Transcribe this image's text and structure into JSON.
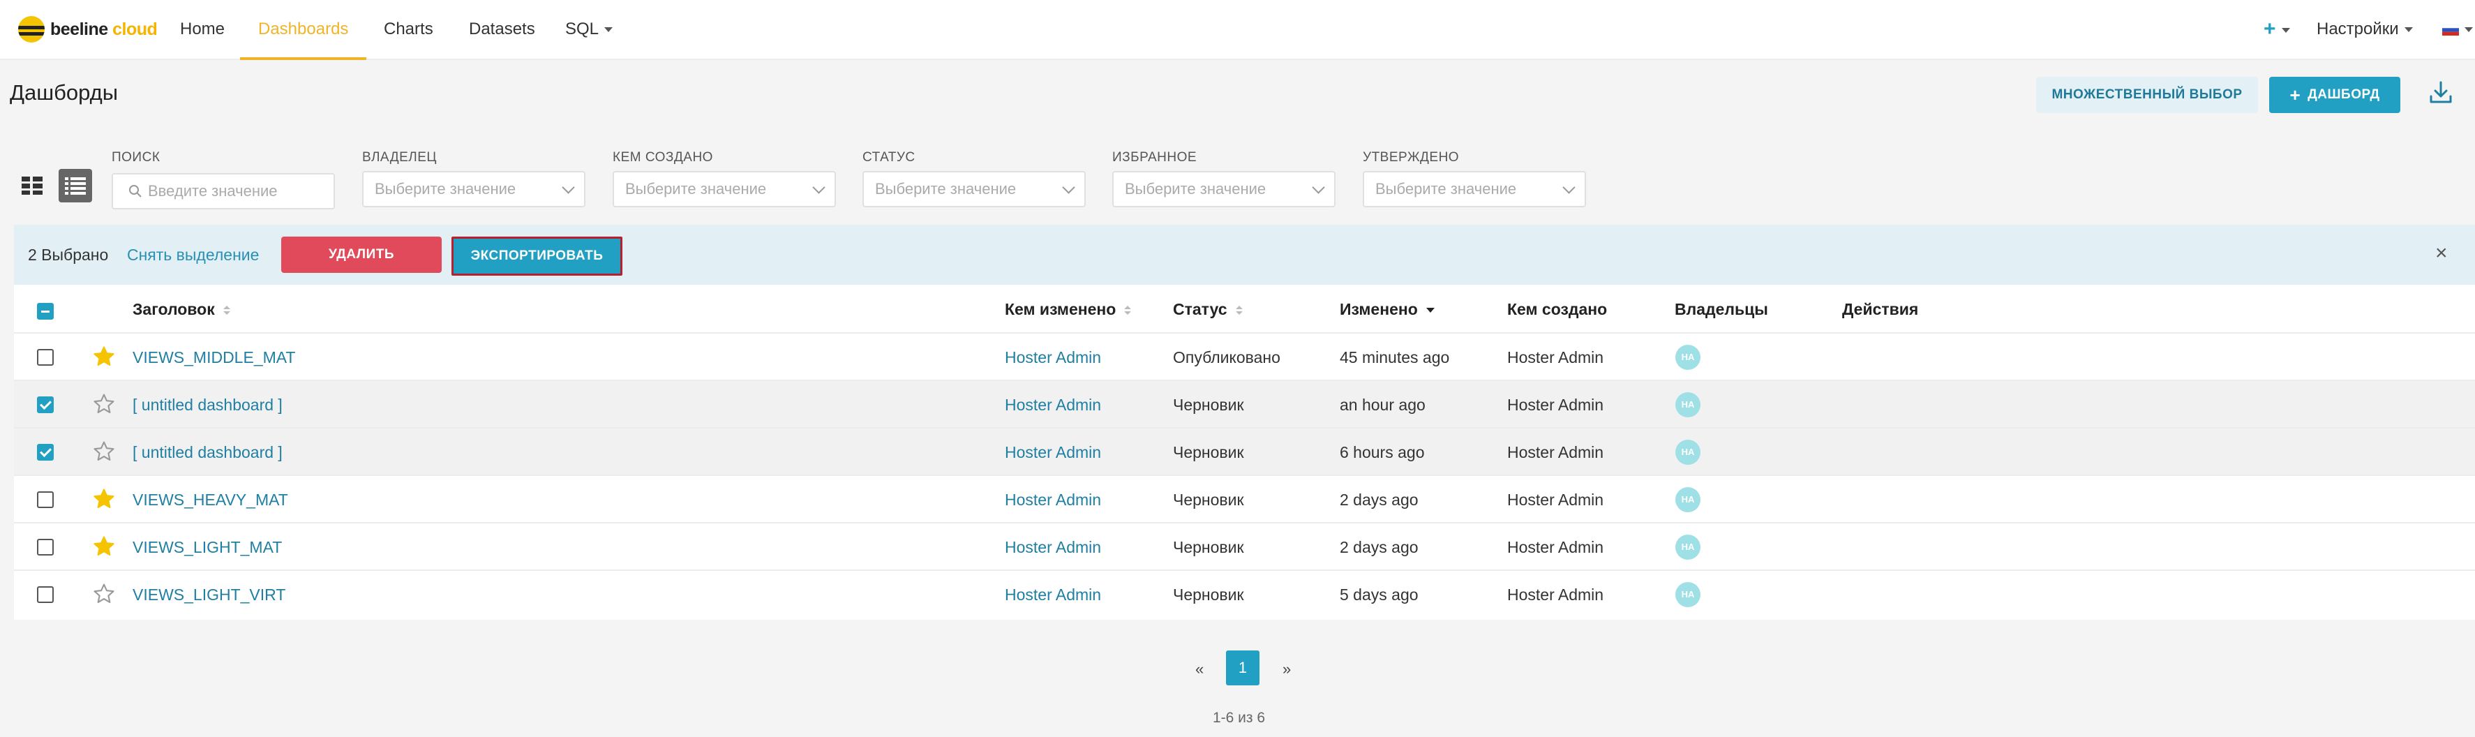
{
  "nav": {
    "logo_primary": "beeline",
    "logo_secondary": "cloud",
    "links": [
      "Home",
      "Dashboards",
      "Charts",
      "Datasets",
      "SQL"
    ],
    "active": "Dashboards",
    "settings": "Настройки"
  },
  "header": {
    "title": "Дашборды",
    "bulk_select_label": "МНОЖЕСТВЕННЫЙ ВЫБОР",
    "add_label": "ДАШБОРД"
  },
  "filters": {
    "search_label": "ПОИСК",
    "search_placeholder": "Введите значение",
    "selects": [
      {
        "label": "ВЛАДЕЛЕЦ",
        "placeholder": "Выберите значение"
      },
      {
        "label": "КЕМ СОЗДАНО",
        "placeholder": "Выберите значение"
      },
      {
        "label": "СТАТУС",
        "placeholder": "Выберите значение"
      },
      {
        "label": "ИЗБРАННОЕ",
        "placeholder": "Выберите значение"
      },
      {
        "label": "УТВЕРЖДЕНО",
        "placeholder": "Выберите значение"
      }
    ]
  },
  "bulk": {
    "count_text": "2 Выбрано",
    "deselect": "Снять выделение",
    "delete": "УДАЛИТЬ",
    "export": "ЭКСПОРТИРОВАТЬ",
    "close": "×"
  },
  "table": {
    "headers": {
      "title": "Заголовок",
      "changed_by": "Кем изменено",
      "status": "Статус",
      "modified": "Изменено",
      "created_by": "Кем создано",
      "owners": "Владельцы",
      "actions": "Действия"
    },
    "rows": [
      {
        "title": "VIEWS_MIDDLE_MAT",
        "changed_by": "Hoster Admin",
        "status": "Опубликовано",
        "modified": "45 minutes ago",
        "created_by": "Hoster Admin",
        "owner": "HA",
        "favorite": true,
        "selected": false
      },
      {
        "title": "[ untitled dashboard ]",
        "changed_by": "Hoster Admin",
        "status": "Черновик",
        "modified": "an hour ago",
        "created_by": "Hoster Admin",
        "owner": "HA",
        "favorite": false,
        "selected": true
      },
      {
        "title": "[ untitled dashboard ]",
        "changed_by": "Hoster Admin",
        "status": "Черновик",
        "modified": "6 hours ago",
        "created_by": "Hoster Admin",
        "owner": "HA",
        "favorite": false,
        "selected": true
      },
      {
        "title": "VIEWS_HEAVY_MAT",
        "changed_by": "Hoster Admin",
        "status": "Черновик",
        "modified": "2 days ago",
        "created_by": "Hoster Admin",
        "owner": "HA",
        "favorite": true,
        "selected": false
      },
      {
        "title": "VIEWS_LIGHT_MAT",
        "changed_by": "Hoster Admin",
        "status": "Черновик",
        "modified": "2 days ago",
        "created_by": "Hoster Admin",
        "owner": "HA",
        "favorite": true,
        "selected": false
      },
      {
        "title": "VIEWS_LIGHT_VIRT",
        "changed_by": "Hoster Admin",
        "status": "Черновик",
        "modified": "5 days ago",
        "created_by": "Hoster Admin",
        "owner": "HA",
        "favorite": false,
        "selected": false
      }
    ]
  },
  "pagination": {
    "prev": "«",
    "current": "1",
    "next": "»",
    "info": "1-6 из 6"
  },
  "colors": {
    "accent": "#21a0c3",
    "brand_yellow": "#f0b429",
    "danger": "#e04a5a",
    "star": "#f5c400"
  }
}
